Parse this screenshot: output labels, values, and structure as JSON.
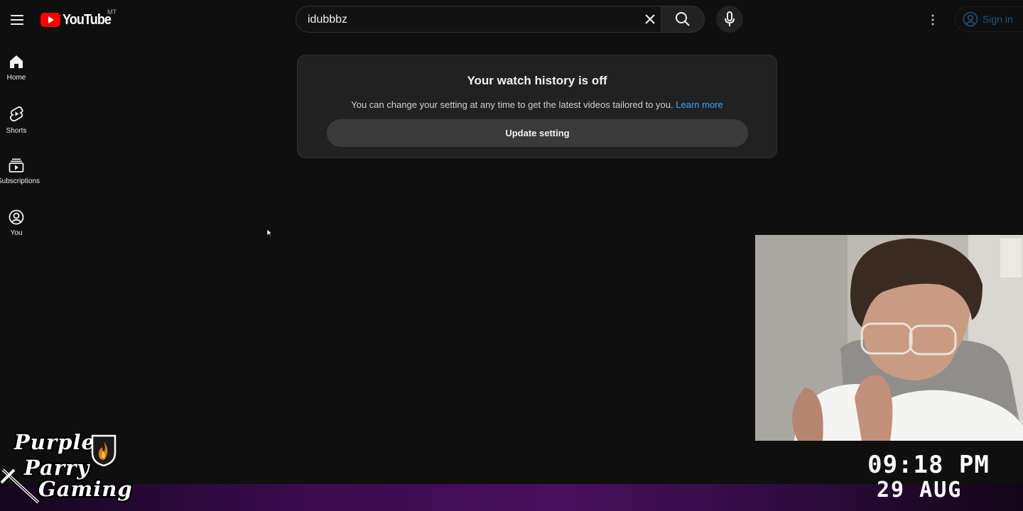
{
  "header": {
    "logo_text": "YouTube",
    "region_code": "MT",
    "search_value": "idubbbz",
    "signin_label": "Sign in"
  },
  "sidebar": {
    "items": [
      {
        "label": "Home",
        "icon": "home-icon"
      },
      {
        "label": "Shorts",
        "icon": "shorts-icon"
      },
      {
        "label": "Subscriptions",
        "icon": "subscriptions-icon"
      },
      {
        "label": "You",
        "icon": "you-icon"
      }
    ]
  },
  "card": {
    "title": "Your watch history is off",
    "text": "You can change your setting at any time to get the latest videos tailored to you.",
    "link": "Learn more",
    "button": "Update setting"
  },
  "overlay": {
    "time": "09:18 PM",
    "date": "29 AUG",
    "channel_logo": [
      "Purple",
      "Parry",
      "Gaming"
    ]
  },
  "colors": {
    "background": "#0f0f0f",
    "brand_red": "#ff0000",
    "link_blue": "#3ea6ff",
    "stream_bar_purple": "#48115e"
  }
}
